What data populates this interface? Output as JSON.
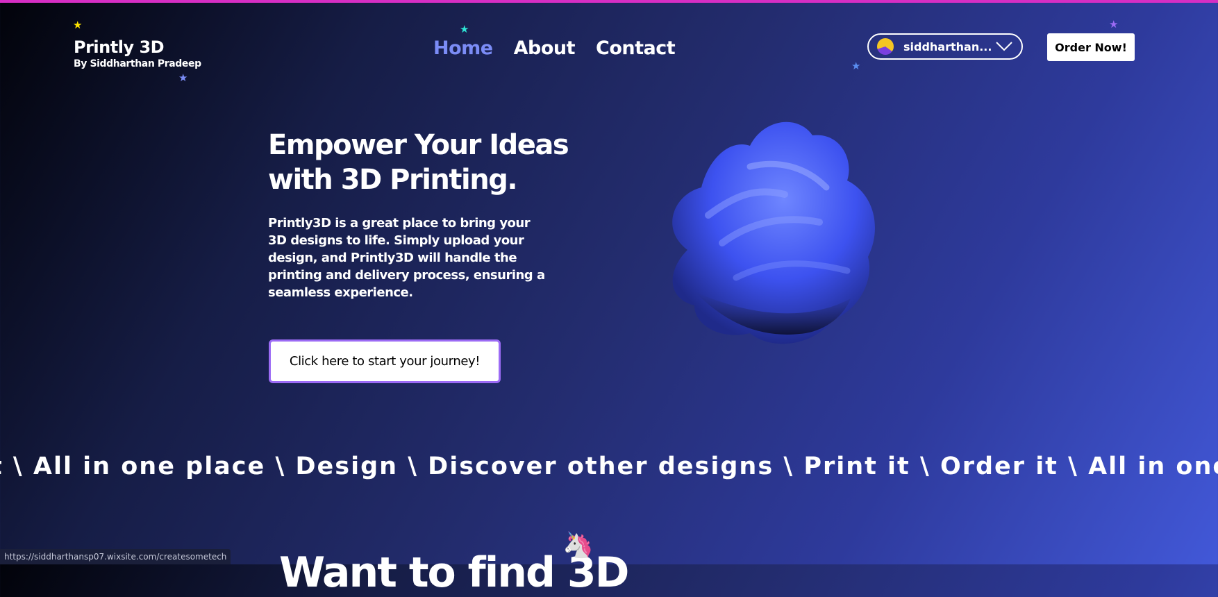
{
  "colors": {
    "accent": "#7b8cf6",
    "top_border": "#d62ec4",
    "cta_border": "#9c6bf5",
    "blob": "#3d52f0"
  },
  "logo": {
    "title": "Printly 3D",
    "subtitle": "By Siddharthan Pradeep"
  },
  "nav": {
    "items": [
      {
        "label": "Home",
        "active": true
      },
      {
        "label": "About",
        "active": false
      },
      {
        "label": "Contact",
        "active": false
      }
    ]
  },
  "account": {
    "name": "siddharthan...",
    "icon": "chevron-down-icon"
  },
  "order_button": {
    "label": "Order Now!"
  },
  "hero": {
    "title": "Empower Your Ideas with 3D Printing.",
    "description": "Printly3D is a great place to bring your 3D designs to life. Simply upload your design, and Printly3D will handle the printing and delivery process, ensuring a seamless experience.",
    "cta": "Click here to start your journey!"
  },
  "marquee": {
    "text": "t \\ All in one place \\ Design \\ Discover other designs \\ Print it \\ Order it \\ All in one"
  },
  "section": {
    "heading": "Want to find 3D"
  },
  "status_bar": {
    "url": "https://siddharthansp07.wixsite.com/createsometech"
  }
}
